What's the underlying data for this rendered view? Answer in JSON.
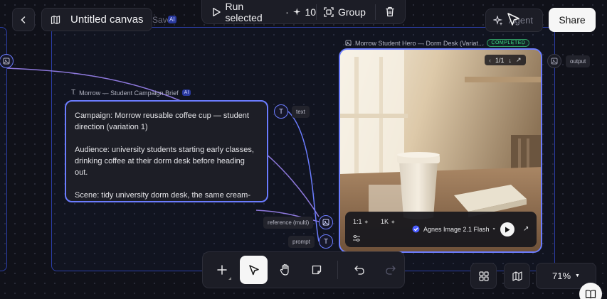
{
  "header": {
    "canvas_title": "Untitled canvas",
    "saved_status": "Saved",
    "saved_badge": "AI"
  },
  "top_toolbar": {
    "run_label": "Run selected",
    "run_separator": "·",
    "run_cost_icon": "sparkle-icon",
    "run_cost": "10",
    "group_label": "Group"
  },
  "top_right": {
    "agent_label": "Agent",
    "share_label": "Share"
  },
  "left_node": {
    "port_icon": "image-icon"
  },
  "text_node": {
    "title": "Morrow — Student Campaign Brief",
    "badge": "AI",
    "paragraphs": [
      "Campaign: Morrow reusable coffee cup — student direction (variation 1)",
      "Audience: university students starting early classes, drinking coffee at their dorm desk before heading out.",
      "Scene: tidy university dorm desk, the same cream-"
    ],
    "output_port_label": "text"
  },
  "image_node": {
    "title": "Morrow Student Hero — Dorm Desk (Variat...",
    "status": "COMPLETED",
    "pager": "1/1",
    "aspect_ratio": "1:1",
    "resolution": "1K",
    "model": "Agnes Image 2.1 Flash",
    "input_ports": {
      "reference": "reference (multi)",
      "prompt": "prompt"
    },
    "output_port_label": "output"
  },
  "bottom_toolbar": {
    "active_tool": "select"
  },
  "bottom_right": {
    "zoom": "71%"
  },
  "colors": {
    "accent": "#6b7cff",
    "completed": "#3ee08a",
    "background": "#101119"
  }
}
